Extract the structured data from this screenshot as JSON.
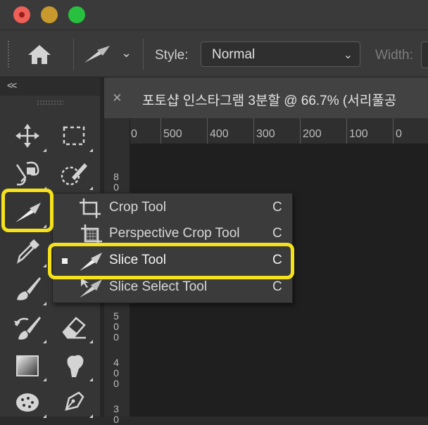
{
  "options_bar": {
    "style_label": "Style:",
    "style_value": "Normal",
    "width_label": "Width:"
  },
  "toolbar": {
    "collapse_label": "<<",
    "tools": [
      {
        "name": "move-tool",
        "icon": "move-icon"
      },
      {
        "name": "marquee-tool",
        "icon": "marquee-icon"
      },
      {
        "name": "lasso-tool",
        "icon": "magnetic-lasso-icon"
      },
      {
        "name": "quick-selection-tool",
        "icon": "quick-selection-icon"
      },
      {
        "name": "slice-tool",
        "icon": "slice-icon",
        "active": true
      },
      {
        "name": "eyedropper-tool",
        "icon": "eyedropper-icon"
      },
      {
        "name": "brush-tool",
        "icon": "brush-icon"
      },
      {
        "name": "history-brush-tool",
        "icon": "history-brush-icon"
      },
      {
        "name": "eraser-tool",
        "icon": "eraser-icon"
      },
      {
        "name": "gradient-tool",
        "icon": "gradient-icon"
      },
      {
        "name": "smudge-tool",
        "icon": "smudge-icon"
      },
      {
        "name": "sponge-tool",
        "icon": "sponge-icon"
      },
      {
        "name": "pen-tool",
        "icon": "pen-icon"
      }
    ]
  },
  "document": {
    "tab_title": "포토샵 인스타그램 3분할 @ 66.7% (서리풀공",
    "ruler_top": [
      "0",
      "500",
      "400",
      "300",
      "200",
      "100",
      "0"
    ],
    "ruler_left": [
      [
        "8",
        "0",
        "0"
      ],
      [
        "5",
        "0",
        "0"
      ],
      [
        "4",
        "0",
        "0"
      ],
      [
        "3",
        "0"
      ]
    ]
  },
  "flyout": {
    "items": [
      {
        "label": "Crop Tool",
        "shortcut": "C",
        "icon": "crop-icon"
      },
      {
        "label": "Perspective Crop Tool",
        "shortcut": "C",
        "icon": "perspective-crop-icon"
      },
      {
        "label": "Slice Tool",
        "shortcut": "C",
        "icon": "slice-icon",
        "selected": true
      },
      {
        "label": "Slice Select Tool",
        "shortcut": "C",
        "icon": "slice-select-icon"
      }
    ]
  },
  "colors": {
    "highlight": "#f5e21b",
    "panel": "#3a3a3a",
    "canvas": "#1f1f1f"
  }
}
